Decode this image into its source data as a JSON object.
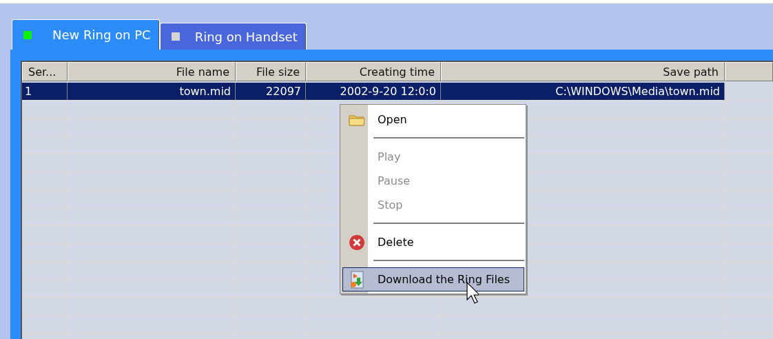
{
  "tabs": [
    {
      "label": "New Ring on PC",
      "selected": true
    },
    {
      "label": "Ring on Handset",
      "selected": false
    }
  ],
  "table": {
    "columns": [
      "Ser...",
      "File name",
      "File size",
      "Creating time",
      "Save path"
    ],
    "rows": [
      {
        "cells": [
          "1",
          "town.mid",
          "22097",
          "2002-9-20 12:0:0",
          "C:\\WINDOWS\\Media\\town.mid"
        ],
        "selected": true
      }
    ]
  },
  "context_menu": {
    "items": [
      {
        "kind": "item",
        "label": "Open",
        "disabled": false,
        "selected": false
      },
      {
        "kind": "separator"
      },
      {
        "kind": "item",
        "label": "Play",
        "disabled": true,
        "selected": false
      },
      {
        "kind": "item",
        "label": "Pause",
        "disabled": true,
        "selected": false
      },
      {
        "kind": "item",
        "label": "Stop",
        "disabled": true,
        "selected": false
      },
      {
        "kind": "separator"
      },
      {
        "kind": "item",
        "label": "Delete",
        "disabled": false,
        "selected": false
      },
      {
        "kind": "separator"
      },
      {
        "kind": "item",
        "label": "Download the Ring Files",
        "disabled": false,
        "selected": true
      }
    ]
  }
}
